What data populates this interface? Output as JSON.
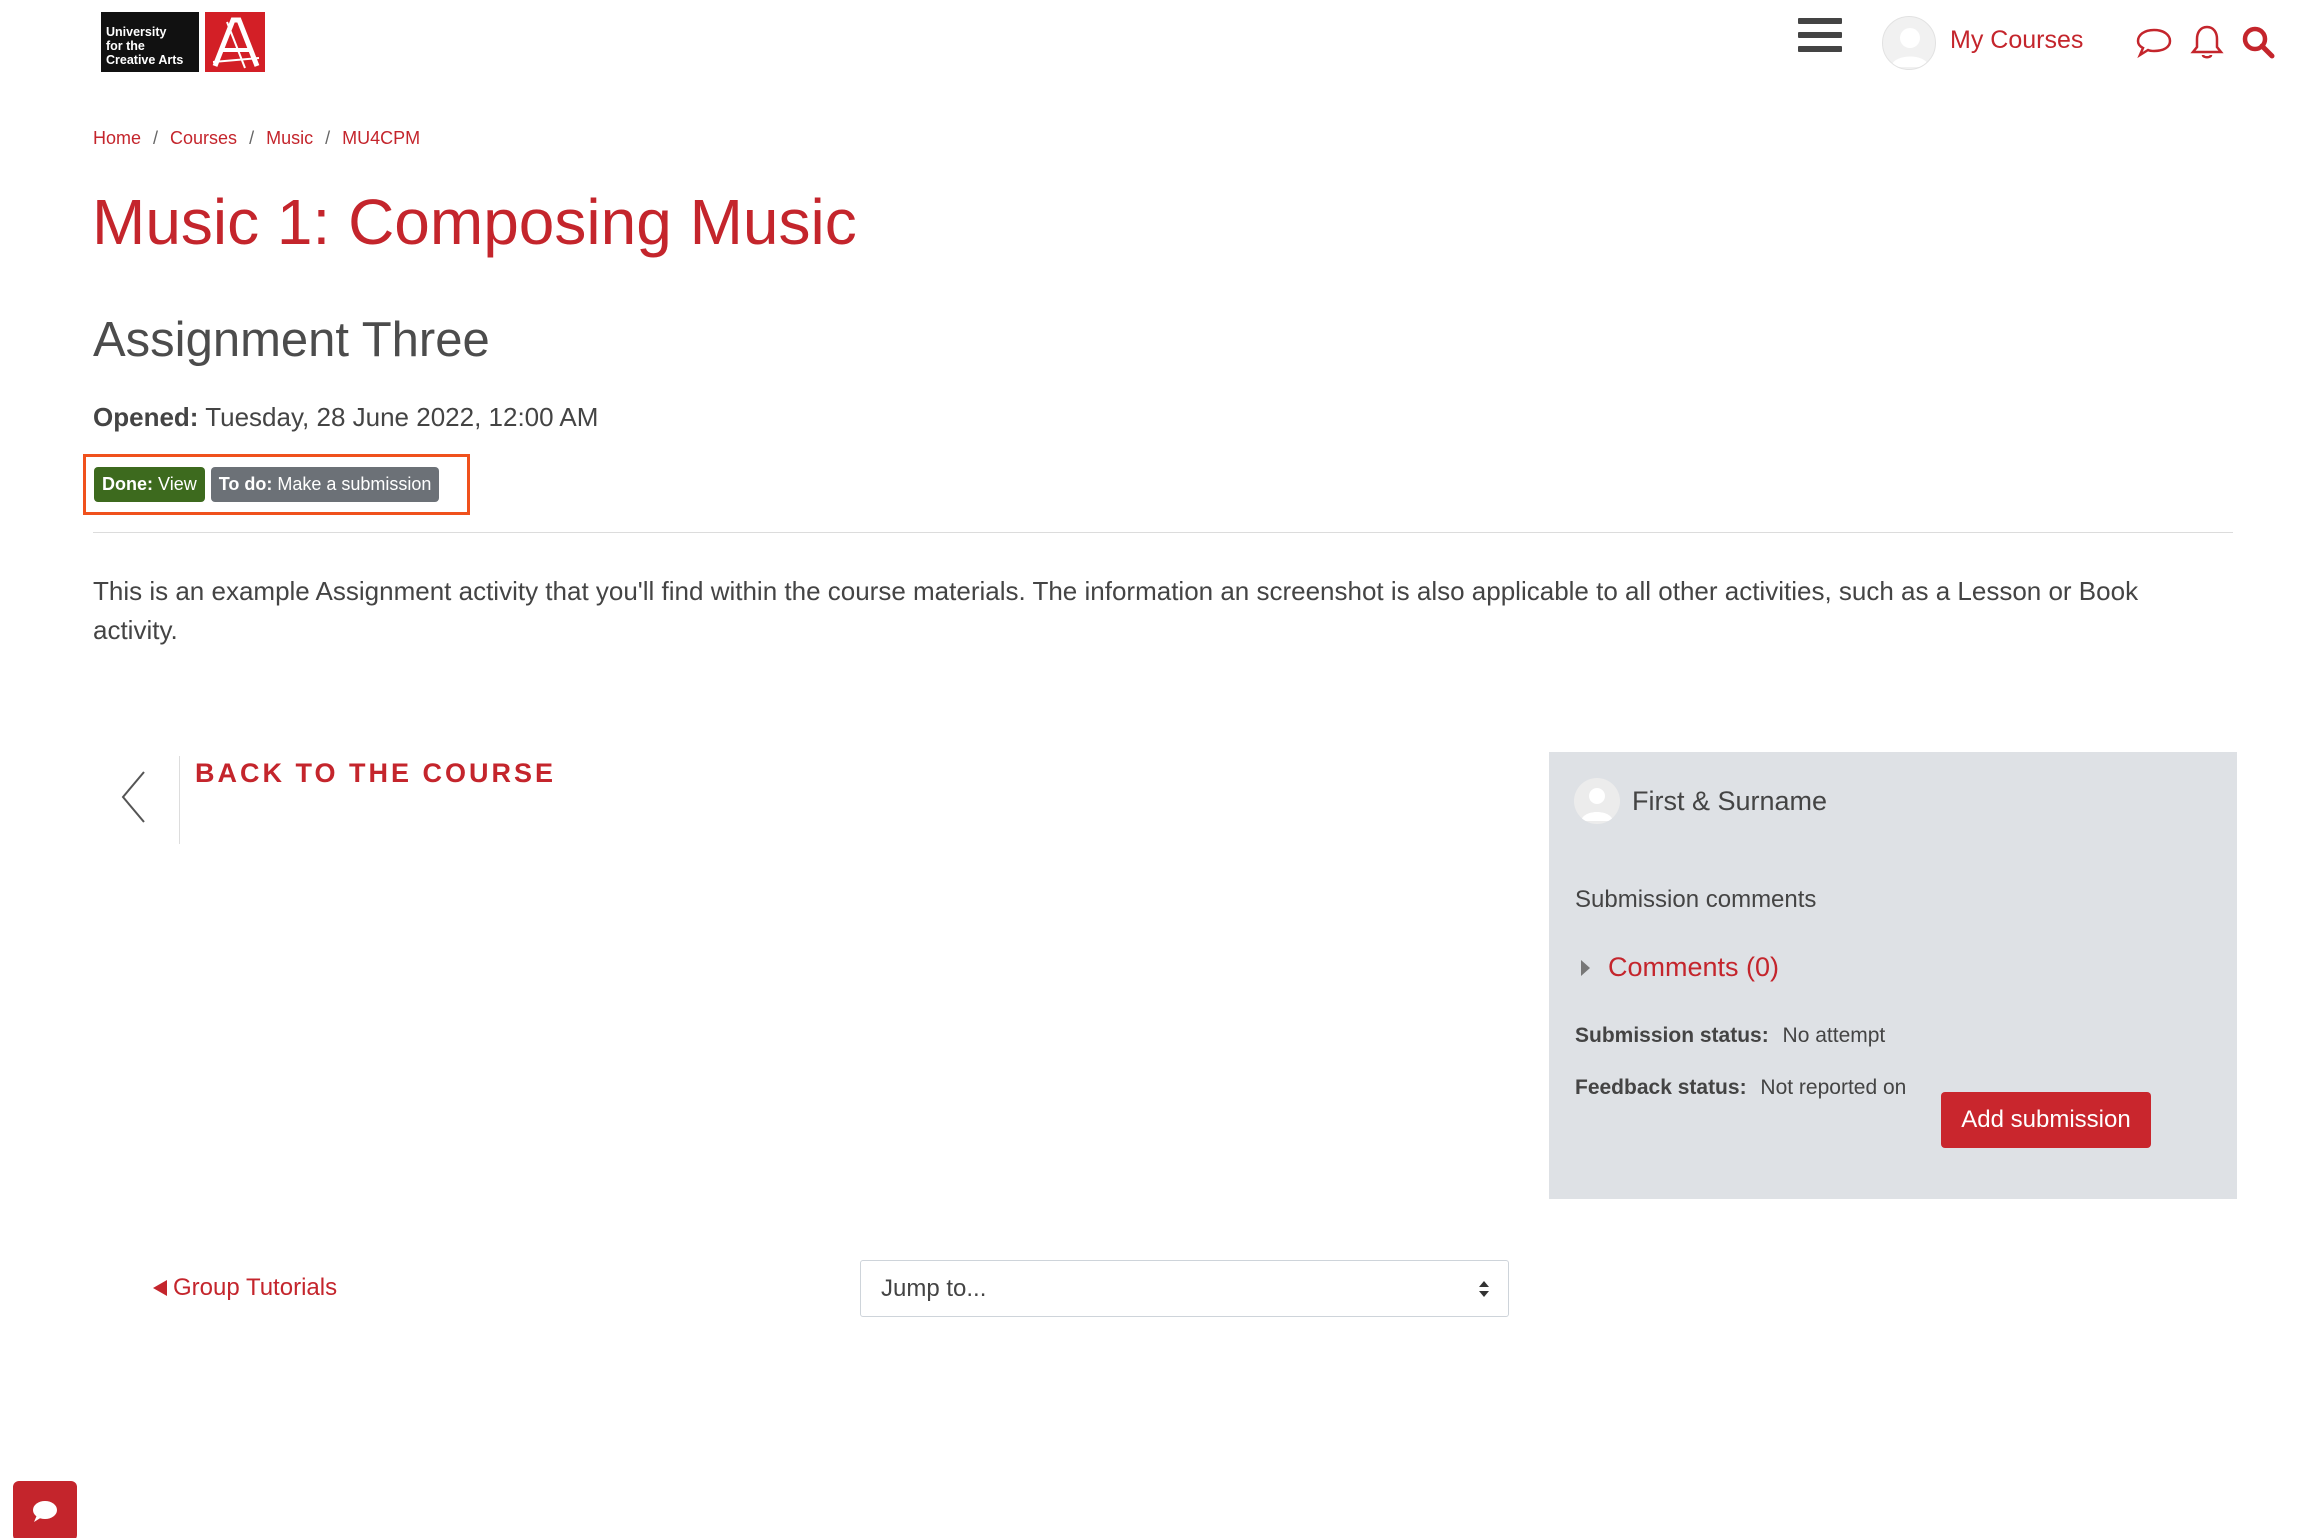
{
  "header": {
    "logo_text": [
      "University",
      "for the",
      "Creative Arts"
    ],
    "my_courses_label": "My Courses",
    "icons": [
      "menu-icon",
      "user-avatar",
      "chat-bubble-icon",
      "bell-icon",
      "search-icon"
    ]
  },
  "breadcrumb": [
    {
      "label": "Home"
    },
    {
      "label": "Courses"
    },
    {
      "label": "Music"
    },
    {
      "label": "MU4CPM"
    }
  ],
  "breadcrumb_separator": "/",
  "page": {
    "course_title": "Music 1: Composing Music",
    "assignment_title": "Assignment Three",
    "opened_label": "Opened:",
    "opened_value": "Tuesday, 28 June 2022, 12:00 AM"
  },
  "badges": {
    "done_label": "Done:",
    "done_value": "View",
    "todo_label": "To do:",
    "todo_value": "Make a submission"
  },
  "description": "This is an example Assignment activity that you'll find within the course materials. The information an screenshot is also applicable to all other activities, such as a Lesson or Book activity.",
  "back_nav": {
    "label": "BACK TO THE COURSE"
  },
  "submission_panel": {
    "user_name": "First & Surname",
    "comments_heading": "Submission comments",
    "comments_link": "Comments (0)",
    "submission_status_label": "Submission status:",
    "submission_status_value": "No attempt",
    "feedback_status_label": "Feedback status:",
    "feedback_status_value": "Not reported on",
    "add_submission_label": "Add submission"
  },
  "footer_nav": {
    "prev_activity": "Group Tutorials",
    "jump_to_placeholder": "Jump to..."
  },
  "colors": {
    "brand_red": "#c4252c",
    "done_green": "#3d6a1e",
    "todo_grey": "#6c7177",
    "highlight_orange": "#f0511d",
    "panel_bg": "#dee1e5"
  }
}
